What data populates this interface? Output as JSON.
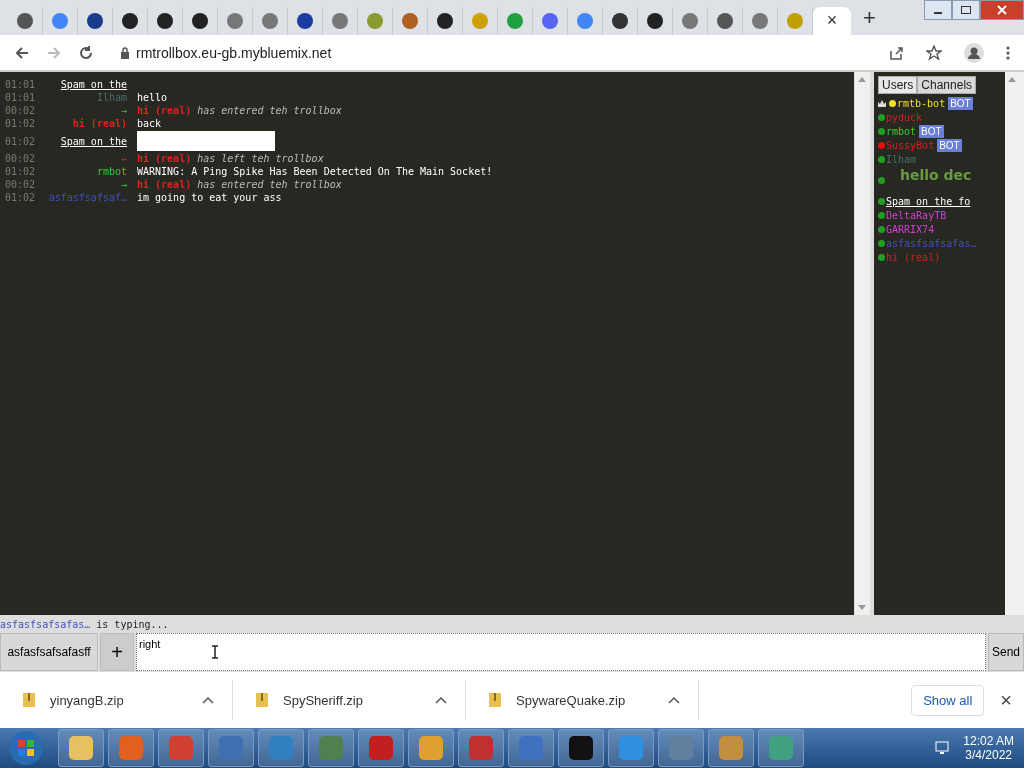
{
  "browser": {
    "tabs": [
      {
        "selected": false
      },
      {
        "selected": false
      },
      {
        "selected": false
      },
      {
        "selected": false
      },
      {
        "selected": false
      },
      {
        "selected": false
      },
      {
        "selected": false
      },
      {
        "selected": false
      },
      {
        "selected": false
      },
      {
        "selected": false
      },
      {
        "selected": false
      },
      {
        "selected": false
      },
      {
        "selected": false
      },
      {
        "selected": false
      },
      {
        "selected": false
      },
      {
        "selected": false
      },
      {
        "selected": false
      },
      {
        "selected": false
      },
      {
        "selected": false
      },
      {
        "selected": false
      },
      {
        "selected": false
      },
      {
        "selected": false
      },
      {
        "selected": false
      },
      {
        "selected": true
      }
    ],
    "close_tab": "×",
    "new_tab": "+",
    "url": "rmtrollbox.eu-gb.mybluemix.net"
  },
  "chat": {
    "messages": [
      {
        "kind": "message",
        "time": "01:01",
        "name": "Spam on the",
        "color": "#ffffff",
        "underlined": true,
        "bold": false
      },
      {
        "kind": "message",
        "time": "01:01",
        "name": "Ilham",
        "color": "#4a6a6a",
        "underlined": false,
        "bold": false,
        "text": "hello"
      },
      {
        "kind": "join",
        "time": "00:02",
        "arrow": "→",
        "name": "hi (real)",
        "color": "#e02020",
        "text": "has entered teh trollbox"
      },
      {
        "kind": "message",
        "time": "01:02",
        "name": "hi (real)",
        "color": "#e02020",
        "underlined": false,
        "bold": true,
        "text": "back"
      },
      {
        "kind": "image",
        "time": "01:02",
        "name": "Spam on the",
        "color": "#ffffff",
        "underlined": true,
        "bold": false
      },
      {
        "kind": "leave",
        "time": "00:02",
        "arrow": "←",
        "name": "hi (real)",
        "color": "#e02020",
        "text": "has left teh trollbox"
      },
      {
        "kind": "message",
        "time": "01:02",
        "name": "rmbot",
        "color": "#30d030",
        "underlined": false,
        "bold": false,
        "text": "WARNING: A Ping Spike Has Been Detected On The Main Socket!"
      },
      {
        "kind": "join",
        "time": "00:02",
        "arrow": "→",
        "name": "hi (real)",
        "color": "#e02020",
        "text": "has entered teh trollbox"
      },
      {
        "kind": "message",
        "time": "01:02",
        "name": "asfasfsafsaf…",
        "color": "#4050c0",
        "underlined": false,
        "bold": false,
        "text": "im going to eat your ass"
      }
    ],
    "typing": {
      "name": "asfasfsafsafas…",
      "text": "is typing..."
    },
    "nickname": "asfasfsafsafasff",
    "add_button": "+",
    "input_value": "right",
    "send_button": "Send"
  },
  "sidebar": {
    "tabs": [
      {
        "label": "Users",
        "selected": true
      },
      {
        "label": "Channels",
        "selected": false
      }
    ],
    "users": [
      {
        "name": "rmtb-bot",
        "color": "#f0e020",
        "idle": true,
        "busy": false,
        "badge": "BOT",
        "owner": true,
        "kind": "normal"
      },
      {
        "name": "pyduck",
        "color": "#d02020",
        "idle": false,
        "busy": false,
        "owner": false,
        "kind": "normal"
      },
      {
        "name": "rmbot",
        "color": "#30d030",
        "idle": false,
        "busy": false,
        "badge": "BOT",
        "owner": false,
        "kind": "normal"
      },
      {
        "name": "SussyBot",
        "color": "#d02020",
        "idle": false,
        "busy": true,
        "badge": "BOT",
        "owner": false,
        "kind": "normal"
      },
      {
        "name": "Ilham",
        "color": "#4a6a6a",
        "idle": false,
        "busy": false,
        "owner": false,
        "kind": "normal"
      },
      {
        "name": "hello dec",
        "color": "#6a9a40",
        "idle": false,
        "busy": false,
        "owner": false,
        "kind": "large"
      },
      {
        "name": "Spam on the fo",
        "color": "#ffffff",
        "idle": false,
        "busy": false,
        "owner": false,
        "kind": "underlined"
      },
      {
        "name": "DeltaRayTB",
        "color": "#d040d0",
        "idle": false,
        "busy": false,
        "owner": false,
        "kind": "normal"
      },
      {
        "name": "GARRIX74",
        "color": "#d040d0",
        "idle": false,
        "busy": false,
        "owner": false,
        "kind": "normal"
      },
      {
        "name": "asfasfsafsafas…",
        "color": "#4050c0",
        "idle": false,
        "busy": false,
        "owner": false,
        "kind": "normal"
      },
      {
        "name": "hi (real)",
        "color": "#d02020",
        "idle": false,
        "busy": false,
        "owner": false,
        "kind": "normal"
      }
    ]
  },
  "downloads": {
    "items": [
      {
        "file": "yinyangB.zip"
      },
      {
        "file": "SpySheriff.zip"
      },
      {
        "file": "SpywareQuake.zip"
      }
    ],
    "show_all": "Show all",
    "close": "×"
  },
  "taskbar": {
    "time": "12:02 AM",
    "date": "3/4/2022"
  }
}
